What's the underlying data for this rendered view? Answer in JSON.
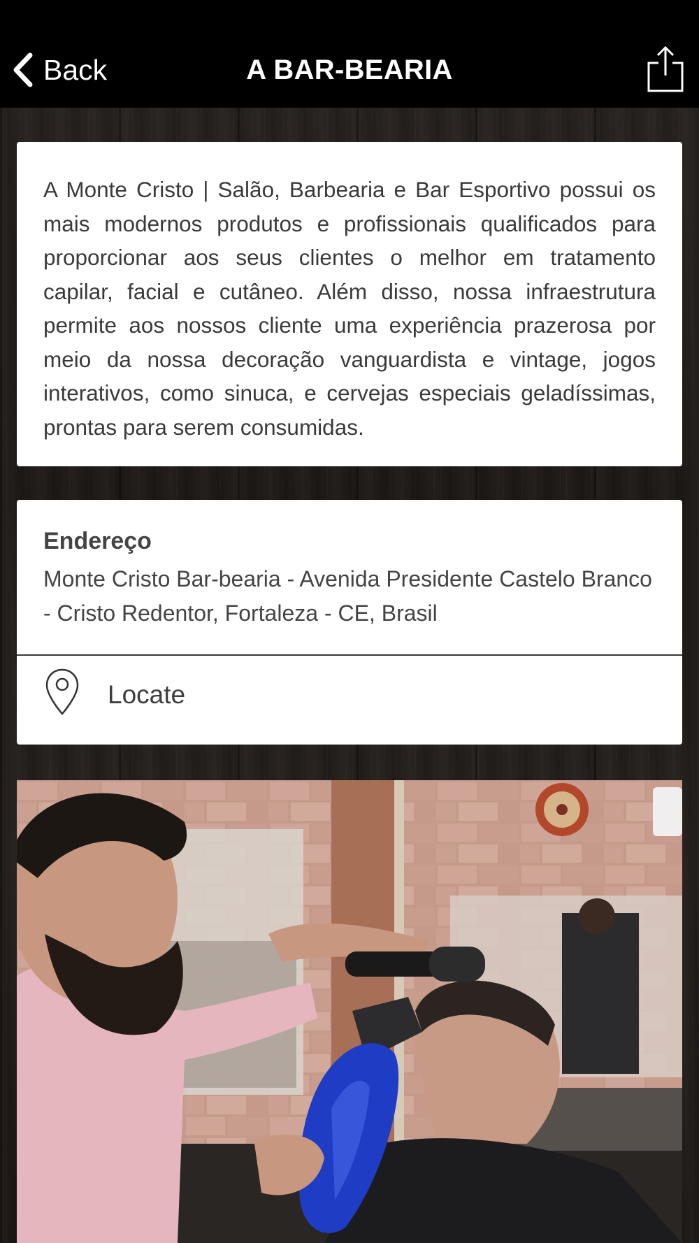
{
  "nav": {
    "back_label": "Back",
    "title": "A BAR-BEARIA"
  },
  "description": {
    "text": "A Monte Cristo | Salão, Barbearia e Bar Esportivo possui os mais modernos produtos e profissionais qualificados para proporcionar aos seus clientes o melhor em tratamento capilar, facial e cutâneo. Além disso, nossa infraestrutura permite aos nossos cliente uma experiência prazerosa por meio da nossa decoração vanguardista e vintage, jogos interativos, como sinuca, e cervejas especiais geladíssimas, prontas para serem consumidas."
  },
  "address": {
    "heading": "Endereço",
    "text": "Monte Cristo Bar-bearia - Avenida Presidente Castelo Branco - Cristo Redentor, Fortaleza - CE, Brasil",
    "locate_label": "Locate"
  },
  "icons": {
    "back": "chevron-left-icon",
    "share": "share-icon",
    "locate": "map-pin-icon"
  },
  "colors": {
    "navbar": "#000000",
    "card": "#ffffff",
    "text": "#3a3a3a"
  }
}
